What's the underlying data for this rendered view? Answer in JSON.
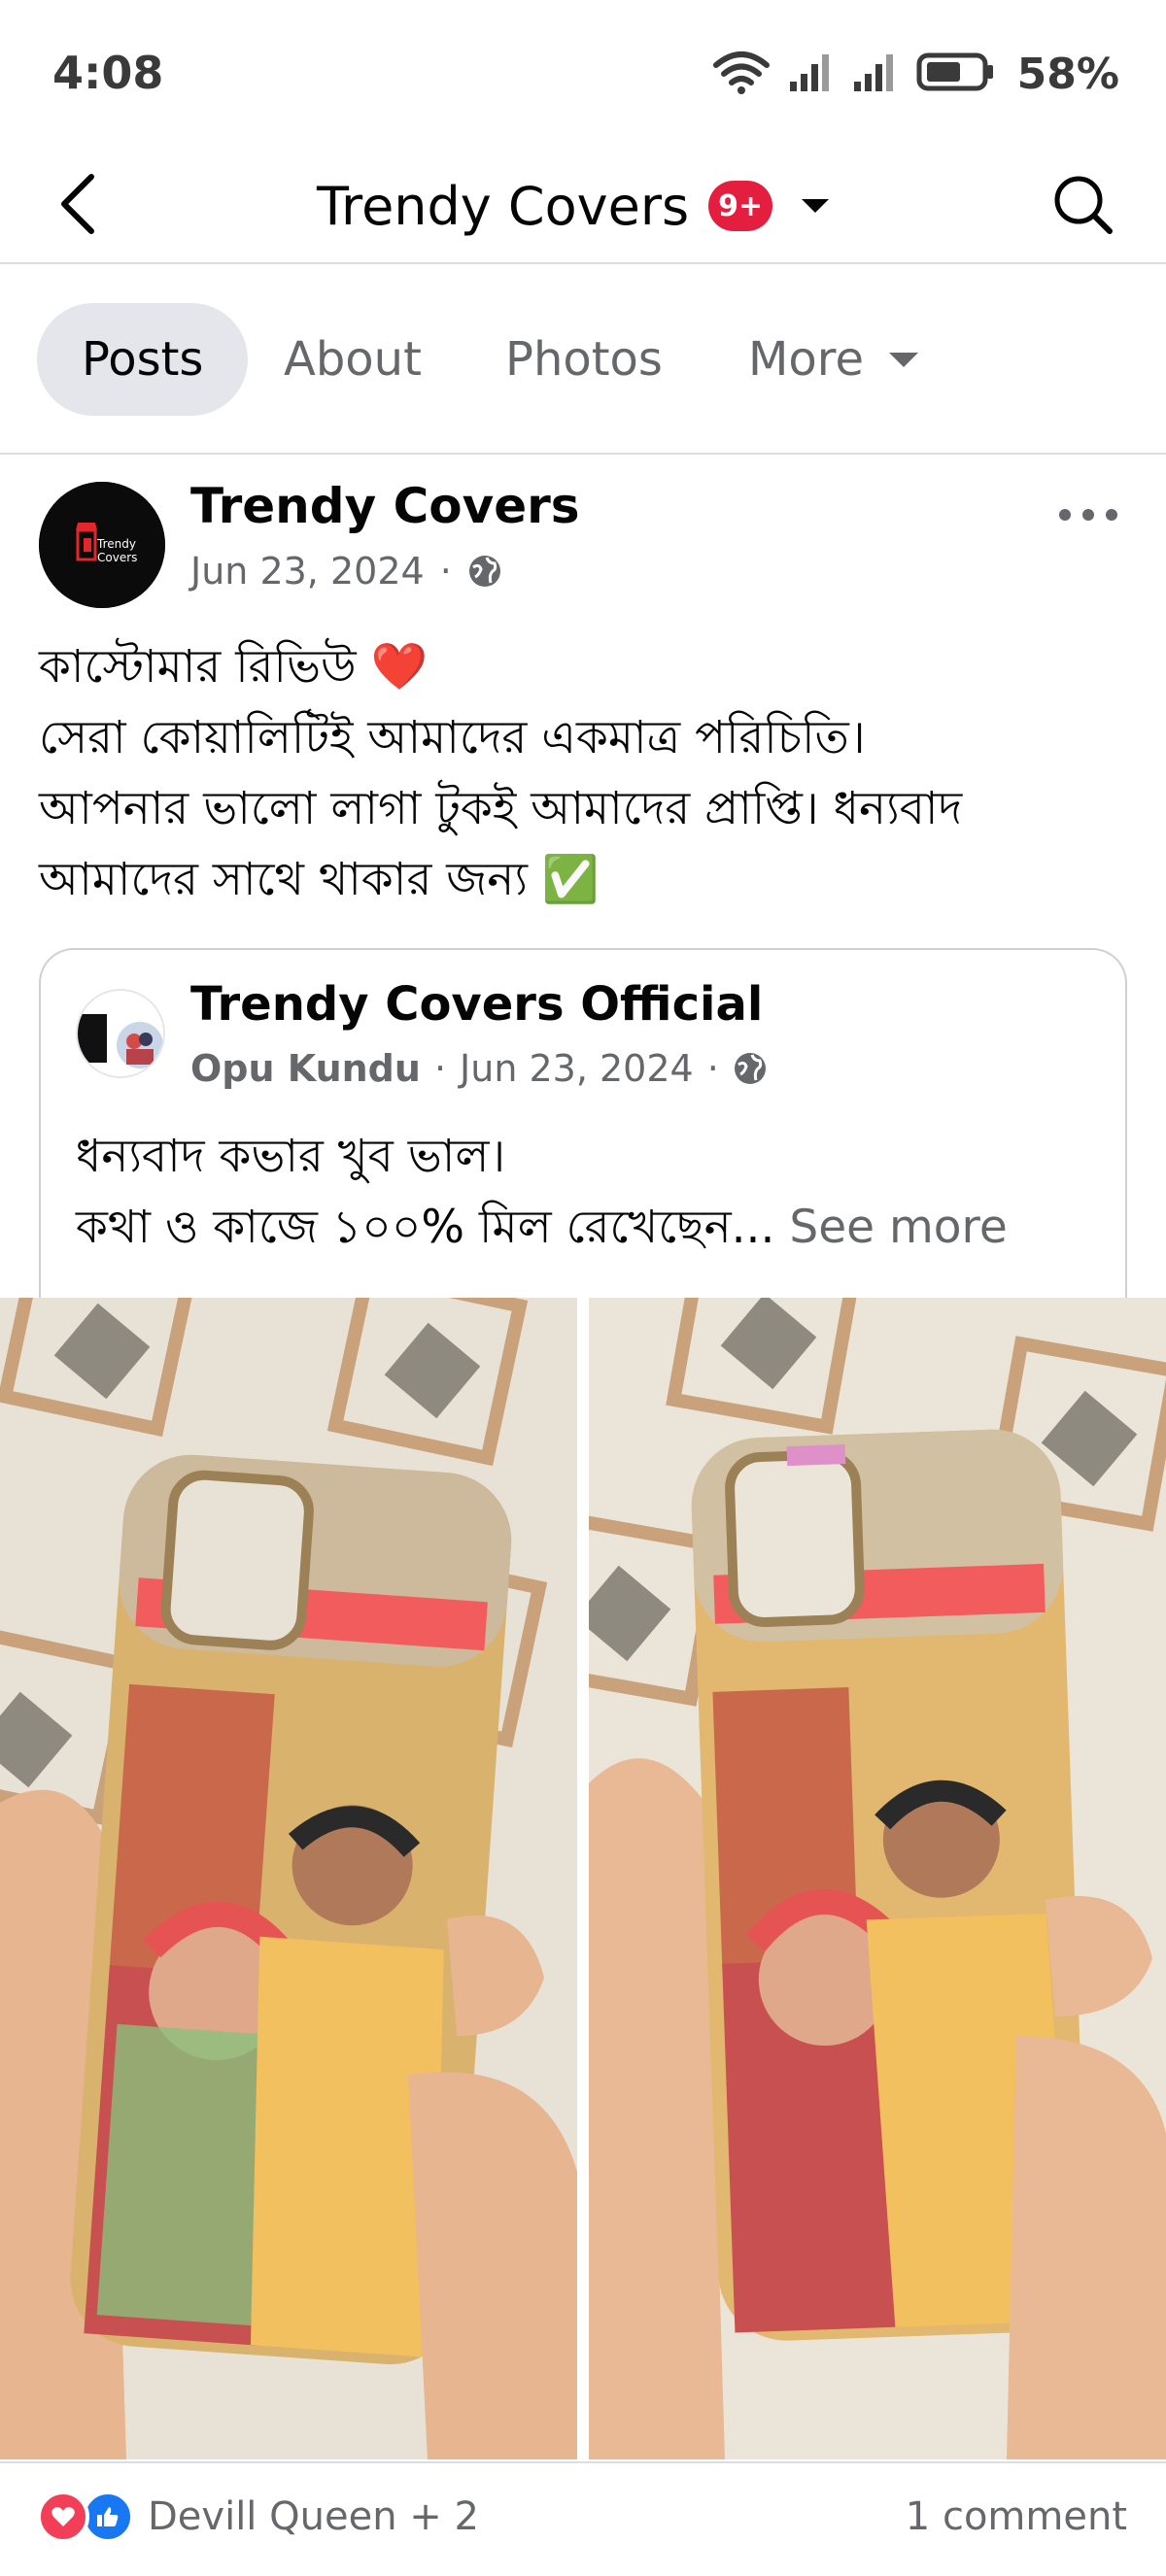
{
  "status_bar": {
    "time": "4:08",
    "battery": "58%"
  },
  "header": {
    "title": "Trendy Covers",
    "badge": "9+"
  },
  "tabs": [
    {
      "label": "Posts",
      "active": true
    },
    {
      "label": "About",
      "active": false
    },
    {
      "label": "Photos",
      "active": false
    },
    {
      "label": "More",
      "active": false
    }
  ],
  "post": {
    "author": "Trendy Covers",
    "date": "Jun 23, 2024",
    "separator": "·",
    "text_lines": [
      "কাস্টোমার রিভিউ ❤️",
      "সেরা কোয়ালিটিই আমাদের একমাত্র পরিচিতি।",
      "আপনার ভালো লাগা টুকই আমাদের প্রাপ্তি। ধন্যবাদ",
      "আমাদের সাথে থাকার জন্য ✅"
    ],
    "avatar_text": "Trendy Covers"
  },
  "shared": {
    "title": "Trendy Covers Official",
    "person": "Opu Kundu",
    "date": "Jun 23, 2024",
    "separator": "·",
    "line1": "ধন্যবাদ কভার খুব ভাল।",
    "line2": "কথা ও কাজে ১০০% মিল রেখেছেন...",
    "see_more": "See more"
  },
  "footer": {
    "reactions_text": "Devill Queen + 2",
    "comments": "1 comment"
  },
  "colors": {
    "accent_blue": "#1877f2",
    "heart_red": "#f33e58",
    "badge_red": "#e41e3f",
    "muted": "#65676b"
  }
}
